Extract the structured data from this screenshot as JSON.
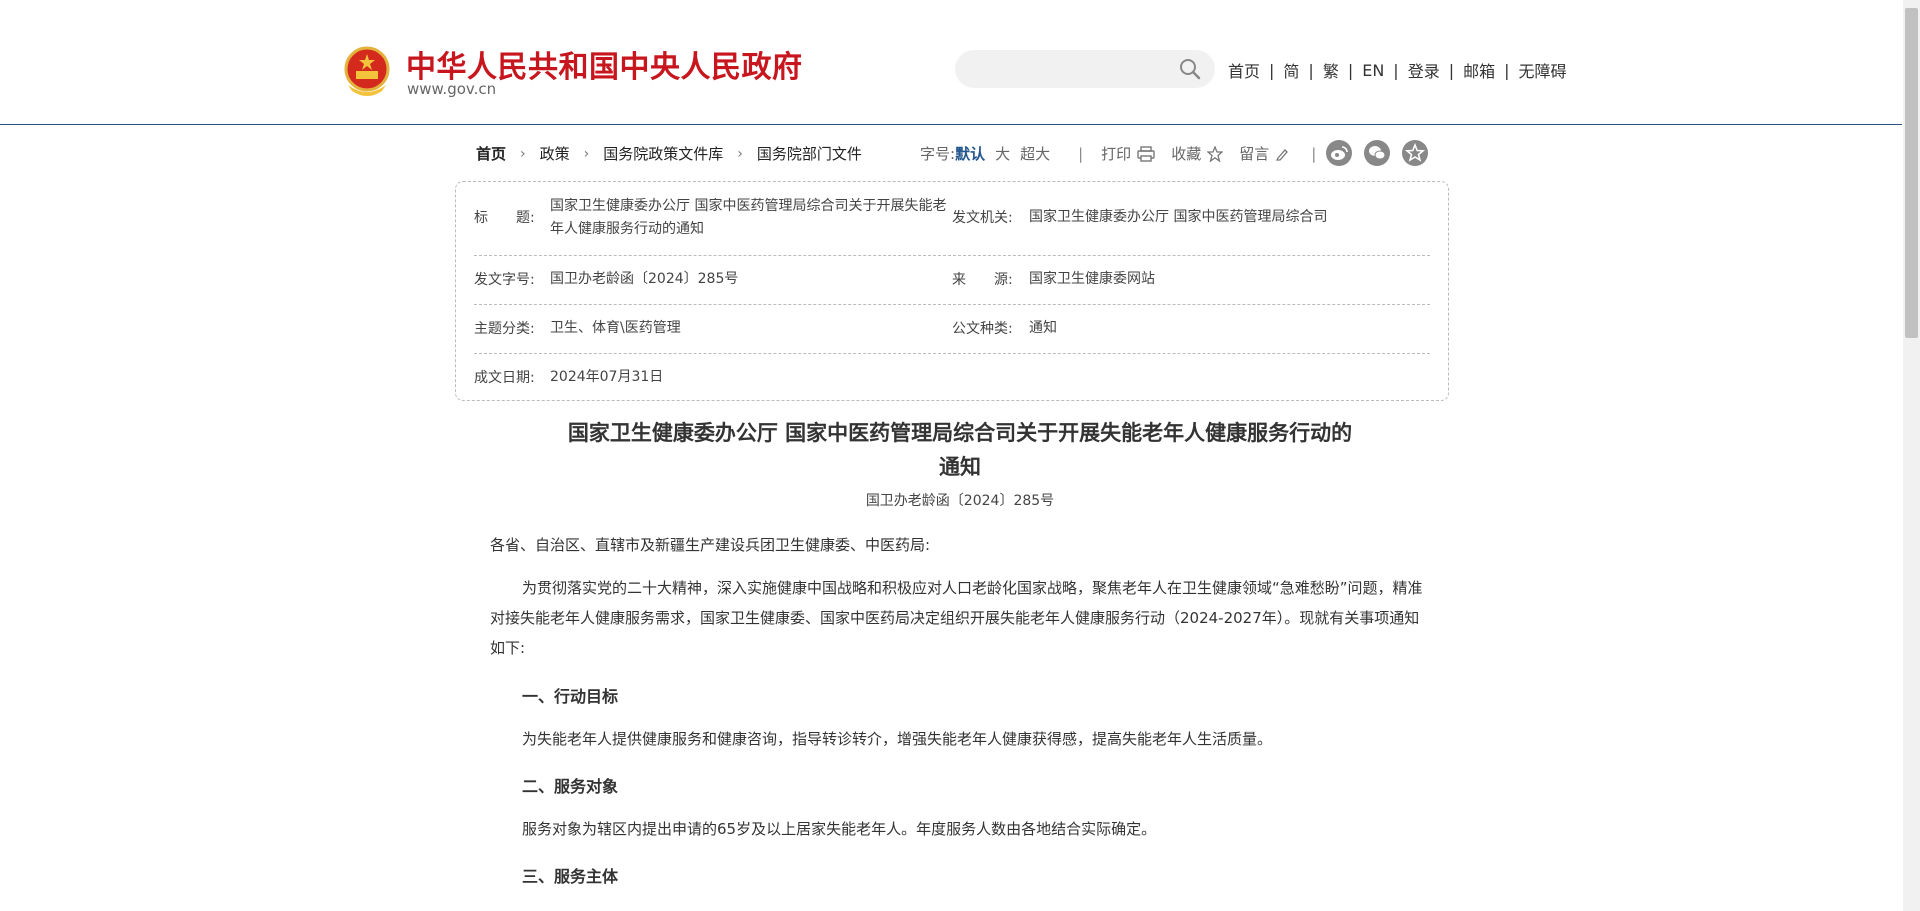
{
  "header": {
    "site_title": "中华人民共和国中央人民政府",
    "site_url": "www.gov.cn",
    "search": {
      "placeholder": ""
    },
    "nav": [
      "首页",
      "简",
      "繁",
      "EN",
      "登录",
      "邮箱",
      "无障碍"
    ]
  },
  "breadcrumb": [
    "首页",
    "政策",
    "国务院政策文件库",
    "国务院部门文件"
  ],
  "toolbar": {
    "font_label": "字号:",
    "font_sizes": [
      "默认",
      "大",
      "超大"
    ],
    "print": "打印",
    "favorite": "收藏",
    "comment": "留言"
  },
  "info": {
    "title_label": "标　　题:",
    "title_value": "国家卫生健康委办公厅 国家中医药管理局综合司关于开展失能老年人健康服务行动的通知",
    "issuer_label": "发文机关:",
    "issuer_value": "国家卫生健康委办公厅 国家中医药管理局综合司",
    "docno_label": "发文字号:",
    "docno_value": "国卫办老龄函〔2024〕285号",
    "source_label": "来　　源:",
    "source_value": "国家卫生健康委网站",
    "topic_label": "主题分类:",
    "topic_value": "卫生、体育\\医药管理",
    "type_label": "公文种类:",
    "type_value": "通知",
    "date_label": "成文日期:",
    "date_value": "2024年07月31日"
  },
  "article": {
    "title_line1": "国家卫生健康委办公厅 国家中医药管理局综合司关于开展失能老年人健康服务行动的",
    "title_line2": "通知",
    "doc_number": "国卫办老龄函〔2024〕285号",
    "salutation": "各省、自治区、直辖市及新疆生产建设兵团卫生健康委、中医药局:",
    "intro": "为贯彻落实党的二十大精神，深入实施健康中国战略和积极应对人口老龄化国家战略，聚焦老年人在卫生健康领域“急难愁盼”问题，精准对接失能老年人健康服务需求，国家卫生健康委、国家中医药局决定组织开展失能老年人健康服务行动（2024-2027年）。现就有关事项通知如下:",
    "h1": "一、行动目标",
    "p1": "为失能老年人提供健康服务和健康咨询，指导转诊转介，增强失能老年人健康获得感，提高失能老年人生活质量。",
    "h2": "二、服务对象",
    "p2": "服务对象为辖区内提出申请的65岁及以上居家失能老年人。年度服务人数由各地结合实际确定。",
    "h3": "三、服务主体"
  }
}
